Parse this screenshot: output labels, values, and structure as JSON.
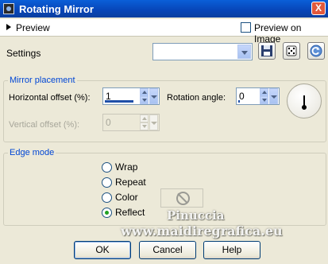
{
  "window": {
    "title": "Rotating Mirror",
    "close_glyph": "X"
  },
  "preview": {
    "label": "Preview",
    "preview_on_image_label": "Preview on Image",
    "preview_on_image_checked": false
  },
  "settings": {
    "label": "Settings",
    "preset_value": ""
  },
  "mirror_placement": {
    "title": "Mirror placement",
    "horizontal_offset_label": "Horizontal offset (%):",
    "horizontal_offset_value": "1",
    "rotation_angle_label": "Rotation angle:",
    "rotation_angle_value": "0",
    "vertical_offset_label": "Vertical offset (%):",
    "vertical_offset_value": "0"
  },
  "edge_mode": {
    "title": "Edge mode",
    "options": [
      {
        "label": "Wrap",
        "selected": false
      },
      {
        "label": "Repeat",
        "selected": false
      },
      {
        "label": "Color",
        "selected": false
      },
      {
        "label": "Reflect",
        "selected": true
      }
    ]
  },
  "watermark": {
    "line1": "Pinuccia",
    "line2": "www.maidiregrafica.eu"
  },
  "buttons": {
    "ok": "OK",
    "cancel": "Cancel",
    "help": "Help"
  }
}
